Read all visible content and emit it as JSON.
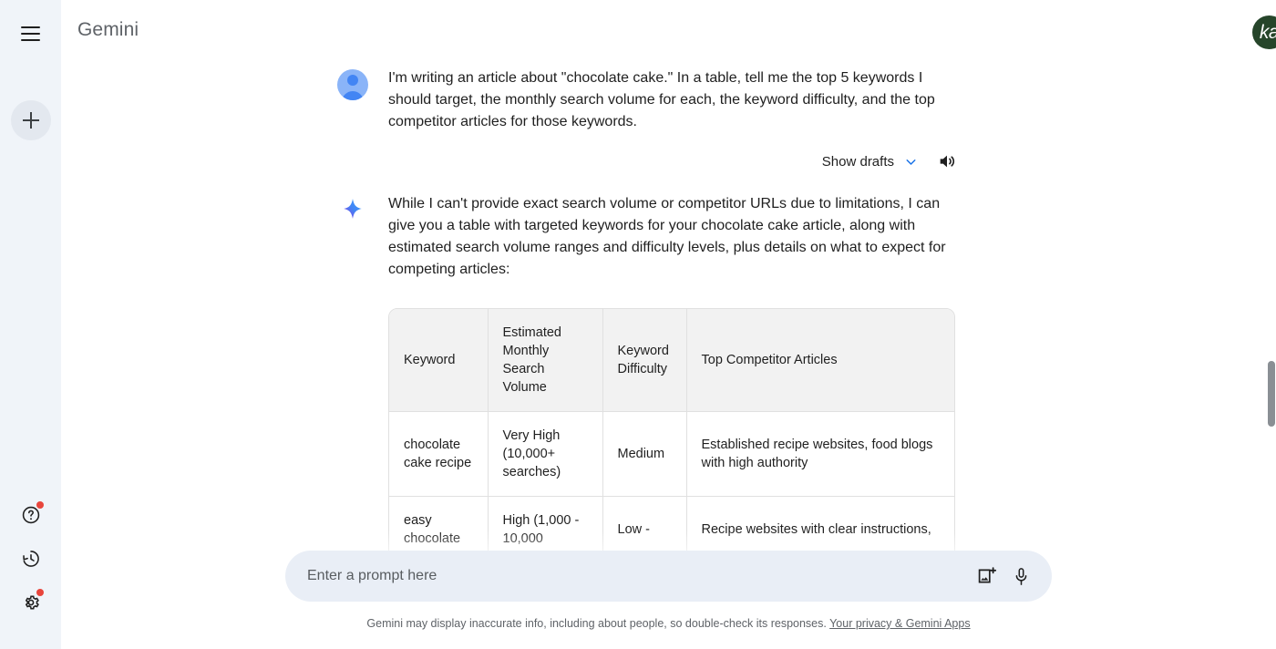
{
  "sidebar": {
    "menu_icon": "hamburger-menu-icon",
    "new_chat_icon": "plus-icon",
    "bottom_items": [
      {
        "name": "help",
        "icon": "help-circle-icon",
        "badge": true
      },
      {
        "name": "activity",
        "icon": "history-clock-icon",
        "badge": false
      },
      {
        "name": "settings",
        "icon": "gear-icon",
        "badge": true
      }
    ]
  },
  "header": {
    "title": "Gemini",
    "avatar_initials": "ka",
    "avatar_color": "#26452a"
  },
  "conversation": {
    "user_message": "I'm writing an article about \"chocolate cake.\" In a table, tell me the top 5 keywords I should target, the monthly search volume for each, the keyword difficulty, and the top competitor articles for those keywords.",
    "show_drafts_label": "Show drafts",
    "chevron_icon": "chevron-down-icon",
    "speaker_icon": "volume-speaker-icon",
    "model_icon": "gemini-sparkle-icon",
    "model_message": "While I can't provide exact search volume or competitor URLs due to limitations, I can give you a table with targeted keywords for your chocolate cake article, along with estimated search volume ranges and difficulty levels, plus details on what to expect for competing articles:"
  },
  "table": {
    "columns": [
      "Keyword",
      "Estimated Monthly Search Volume",
      "Keyword Difficulty",
      "Top Competitor Articles"
    ],
    "rows": [
      {
        "keyword": "chocolate cake recipe",
        "volume": "Very High (10,000+ searches)",
        "difficulty": "Medium",
        "competitors": "Established recipe websites, food blogs with high authority"
      },
      {
        "keyword": "easy chocolate",
        "volume": "High (1,000 - 10,000",
        "difficulty": "Low -",
        "competitors": "Recipe websites with clear instructions,"
      }
    ]
  },
  "composer": {
    "placeholder": "Enter a prompt here",
    "value": "",
    "image_icon": "add-image-icon",
    "mic_icon": "microphone-icon"
  },
  "footer": {
    "disclaimer": "Gemini may display inaccurate info, including about people, so double-check its responses.",
    "link_text": "Your privacy & Gemini Apps"
  },
  "colors": {
    "sidebar_bg": "#f0f4f9",
    "composer_bg": "#e9eef6",
    "accent_blue": "#1a73e8",
    "badge_red": "#e8453c"
  }
}
